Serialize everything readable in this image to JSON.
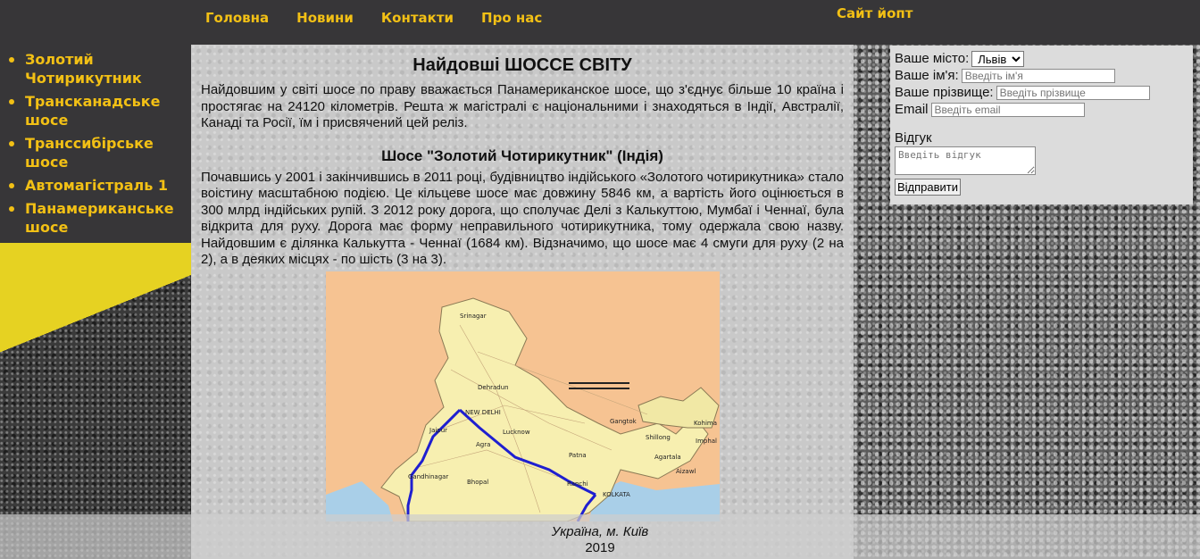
{
  "header": {
    "nav": [
      "Головна",
      "Новини",
      "Контакти",
      "Про нас"
    ],
    "site_title": "Сайт йопт"
  },
  "sidebar": {
    "items": [
      "Золотий Чотирикутник",
      "Трансканадське шосе",
      "Транссибірське шосе",
      "Автомагістраль 1",
      "Панамериканське шосе"
    ]
  },
  "main": {
    "title": "Найдовші ШОССЕ СВІТУ",
    "intro": "Найдовшим у світі шосе по праву вважається Панамериканское шосе, що з'єднує більше 10 країна і простягає на 24120 кілометрів. Решта ж магістралі є національними і знаходяться в Індії, Австралії, Канаді та Росії, їм і присвячений цей реліз.",
    "section_title": "Шосе \"Золотий Чотирикутник\" (Індія)",
    "section_text": "Почавшись у 2001 і закінчившись в 2011 році, будівництво індійського «Золотого чотирикутника» стало воістину масштабною подією. Це кільцеве шосе має довжину 5846 км, а вартість його оцінюється в 300 млрд індійських рупій. З 2012 року дорога, що сполучає Делі з Калькуттою, Мумбаї і Ченнаї, була відкрита для руху. Дорога має форму неправильного чотирикутника, тому одержала свою назву. Найдовшим є ділянка Калькутта - Ченнаї (1684 км). Відзначимо, що шосе має 4 смуги для руху (2 на 2), а в деяких місцях - по шість (3 на 3).",
    "map_labels": {
      "new_delhi": "NEW DELHI",
      "lucknow": "Lucknow",
      "jaipur": "Jaipur",
      "kolkata": "KOLKATA",
      "bhopal": "Bhopal",
      "gandhinagar": "Gandhinagar",
      "dehradun": "Dehradun",
      "agra": "Agra",
      "ranchi": "Ranchi",
      "patna": "Patna",
      "imphal": "Imphal",
      "aizawl": "Aizawl",
      "kohima": "Kohima",
      "shillong": "Shillong",
      "agartala": "Agartala",
      "srinagar": "Srinagar",
      "gangtok": "Gangtok"
    }
  },
  "form": {
    "city_label": "Ваше місто:",
    "city_value": "Львів",
    "name_label": "Ваше ім'я:",
    "name_placeholder": "Введіть ім'я",
    "surname_label": "Ваше прізвище:",
    "surname_placeholder": "Введіть прізвище",
    "email_label": "Email",
    "email_placeholder": "Введіть email",
    "review_label": "Відгук",
    "review_placeholder": "Введіть відгук",
    "submit_label": "Відправити"
  },
  "footer": {
    "location": "Україна, м. Київ",
    "year": "2019"
  },
  "colors": {
    "accent_yellow": "#f2c015",
    "dark_bar": "#373638",
    "route_blue": "#1f1fd0"
  }
}
